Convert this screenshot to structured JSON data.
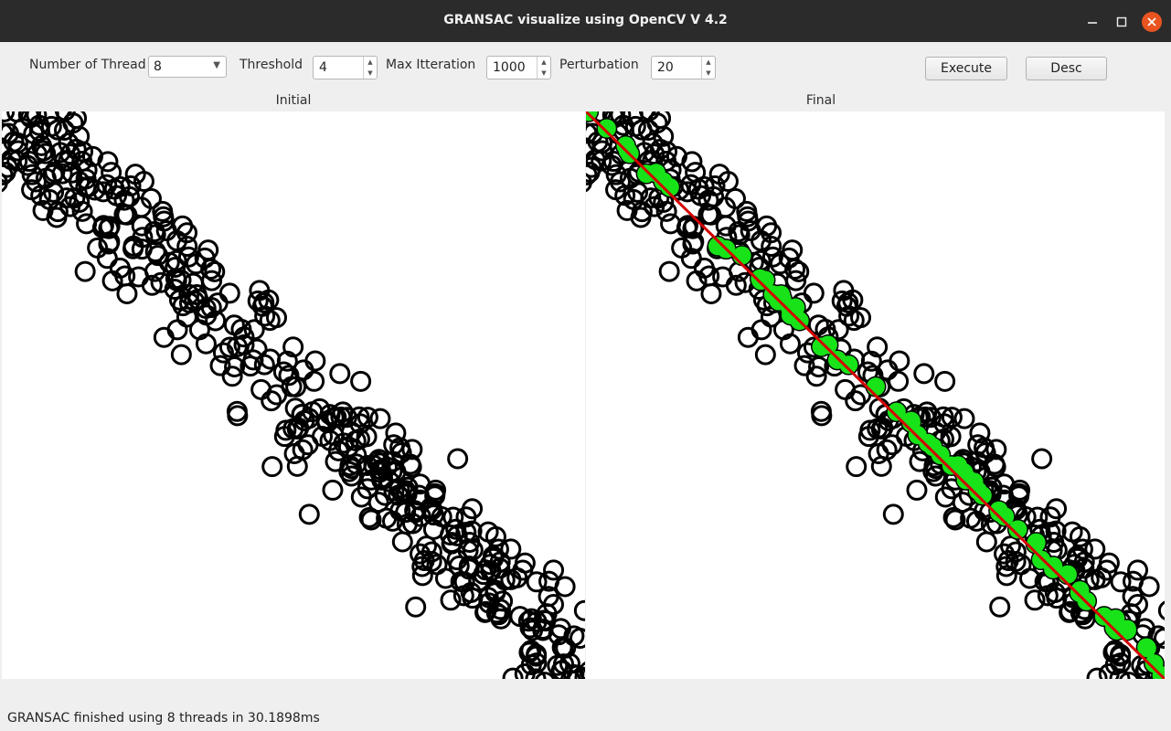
{
  "window": {
    "title": "GRANSAC visualize using OpenCV V 4.2",
    "accent_close": "#e95420"
  },
  "controls": {
    "threads_label": "Number of Thread",
    "threads_value": "8",
    "threshold_label": "Threshold",
    "threshold_value": "4",
    "max_iter_label": "Max Itteration",
    "max_iter_value": "1000",
    "perturbation_label": "Perturbation",
    "perturbation_value": "20",
    "execute_label": "Execute",
    "desc_label": "Desc"
  },
  "panels": {
    "initial_title": "Initial",
    "final_title": "Final"
  },
  "status": {
    "text": "GRANSAC finished using 8 threads in 30.1898ms"
  },
  "icons": {
    "close": "close-icon",
    "maximize": "maximize-icon",
    "minimize": "minimize-icon",
    "combo_arrow": "chevron-down-icon",
    "spin_up": "chevron-up-icon",
    "spin_down": "chevron-down-icon"
  },
  "plot_colors": {
    "outlier_ring": "#000000",
    "inlier": "#18e218",
    "model_line": "#d40000"
  }
}
